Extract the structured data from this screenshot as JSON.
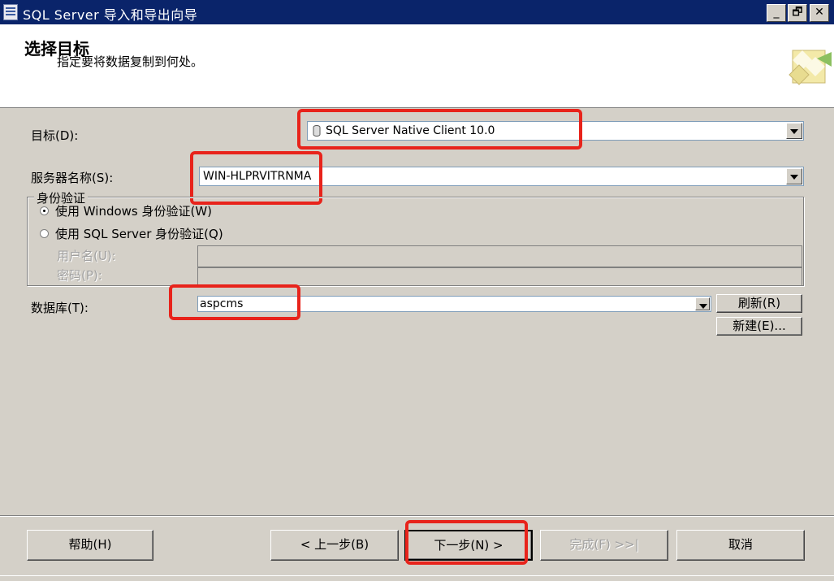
{
  "window": {
    "title": "SQL Server 导入和导出向导",
    "minimize_label": "_",
    "restore_label": "🗗",
    "close_label": "✕"
  },
  "header": {
    "title": "选择目标",
    "subtitle": "指定要将数据复制到何处。",
    "icon": "wizard-graphic-icon"
  },
  "form": {
    "destination_label": "目标(D):",
    "destination_value": "SQL Server Native Client 10.0",
    "destination_icon": "database-provider-icon",
    "server_label": "服务器名称(S):",
    "server_value": "WIN-HLPRVITRNMA",
    "auth_group_label": "身份验证",
    "auth_windows_label": "使用 Windows 身份验证(W)",
    "auth_sql_label": "使用 SQL Server 身份验证(Q)",
    "auth_selected": "windows",
    "username_label": "用户名(U):",
    "password_label": "密码(P):",
    "database_label": "数据库(T):",
    "database_value": "aspcms",
    "refresh_button": "刷新(R)",
    "new_button": "新建(E)..."
  },
  "footer": {
    "help_button": "帮助(H)",
    "back_button": "< 上一步(B)",
    "next_button": "下一步(N) >",
    "finish_button": "完成(F) >>|",
    "cancel_button": "取消"
  },
  "colors": {
    "titlebar": "#0a246a",
    "highlight": "#e8231b",
    "dialog_bg": "#d4d0c8"
  }
}
